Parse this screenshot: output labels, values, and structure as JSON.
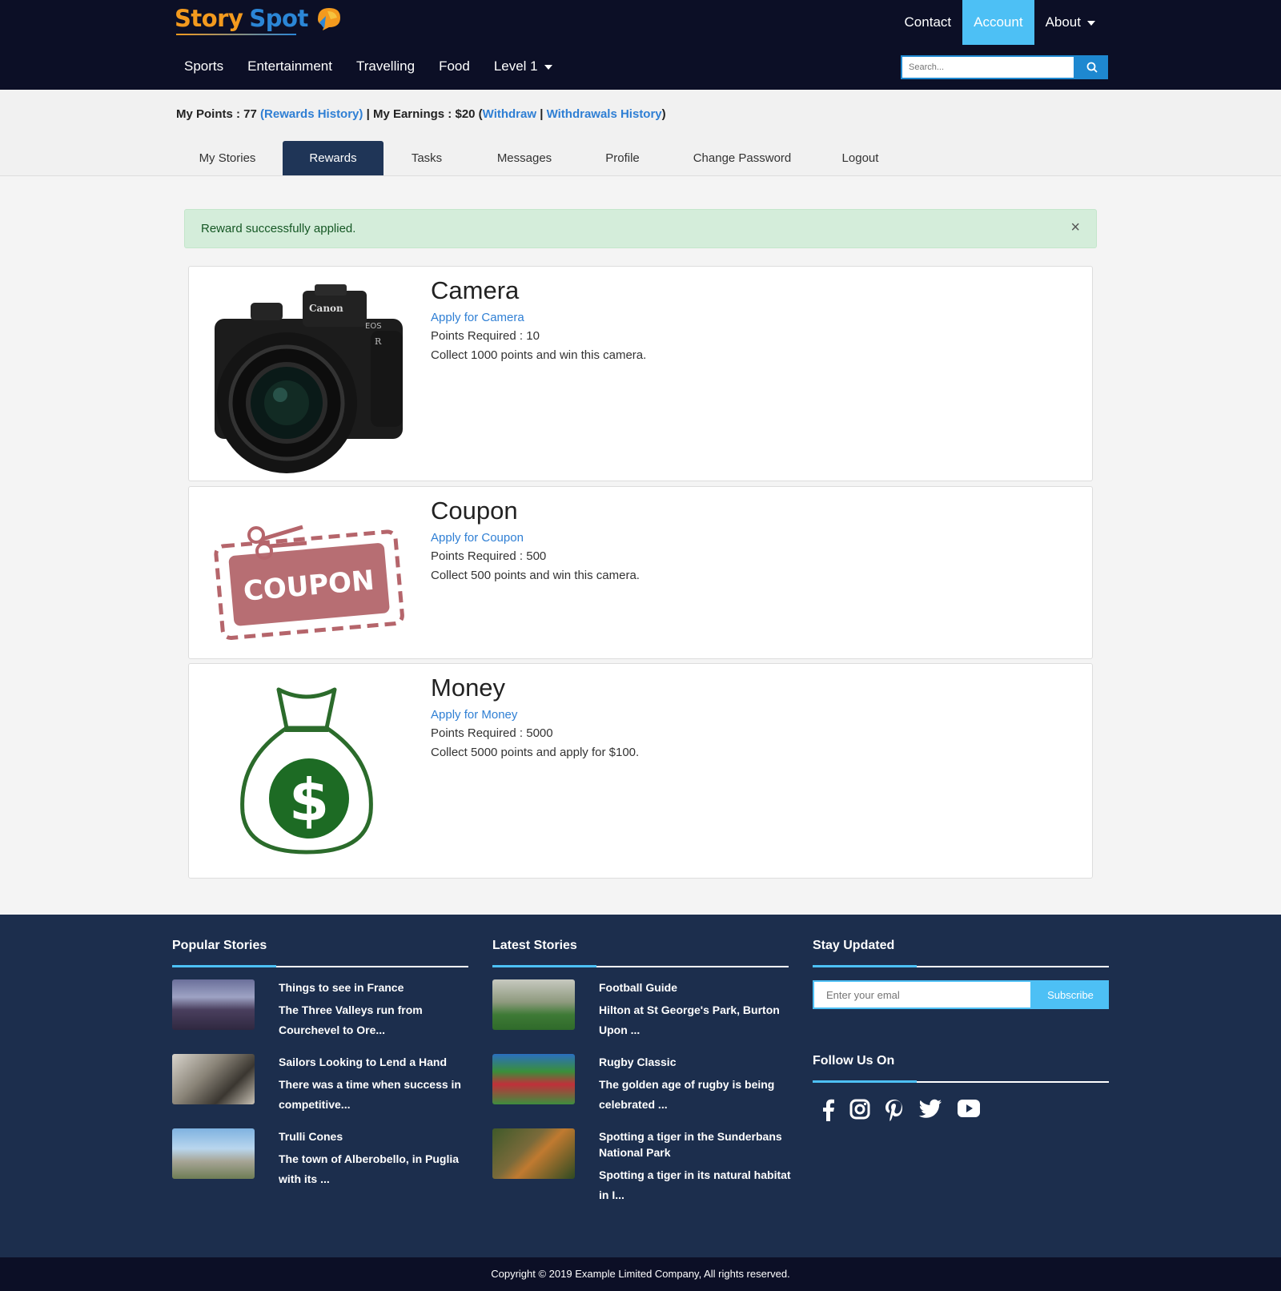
{
  "brand": {
    "word1": "Story",
    "word2": "Spot"
  },
  "topnav": {
    "contact": "Contact",
    "account": "Account",
    "about": "About"
  },
  "catnav": {
    "sports": "Sports",
    "entertainment": "Entertainment",
    "travelling": "Travelling",
    "food": "Food",
    "level": "Level 1"
  },
  "search": {
    "placeholder": "Search..."
  },
  "points": {
    "label": "My Points : 77",
    "rewards_history": "(Rewards History)",
    "sep1": " | ",
    "earnings": "My Earnings : $20 (",
    "withdraw": "Withdraw",
    "sep2": " | ",
    "withdrawals_history": "Withdrawals History",
    "close_paren": ")"
  },
  "tabs": [
    "My Stories",
    "Rewards",
    "Tasks",
    "Messages",
    "Profile",
    "Change Password",
    "Logout"
  ],
  "alert": {
    "message": "Reward successfully applied.",
    "close": "×"
  },
  "rewards": [
    {
      "title": "Camera",
      "apply": "Apply for Camera",
      "points": "Points Required : 10",
      "desc": "Collect 1000 points and win this camera."
    },
    {
      "title": "Coupon",
      "apply": "Apply for Coupon",
      "points": "Points Required : 500",
      "desc": "Collect 500 points and win this camera.",
      "image_text": "COUPON"
    },
    {
      "title": "Money",
      "apply": "Apply for Money",
      "points": "Points Required : 5000",
      "desc": "Collect 5000 points and apply for $100."
    }
  ],
  "footer": {
    "popular": {
      "heading": "Popular Stories",
      "items": [
        {
          "title": "Things to see in France",
          "excerpt": "The Three Valleys run from Courchevel to Ore..."
        },
        {
          "title": "Sailors Looking to Lend a Hand",
          "excerpt": "There was a time when success in competitive..."
        },
        {
          "title": "Trulli Cones",
          "excerpt": "The town of Alberobello, in Puglia with its ..."
        }
      ]
    },
    "latest": {
      "heading": "Latest Stories",
      "items": [
        {
          "title": "Football Guide",
          "excerpt": "Hilton at St George's Park, Burton Upon ..."
        },
        {
          "title": "Rugby Classic",
          "excerpt": "The golden age of rugby is being celebrated ..."
        },
        {
          "title": "Spotting a tiger in the Sunderbans National Park",
          "excerpt": "Spotting a tiger in its natural habitat in I..."
        }
      ]
    },
    "stay": {
      "heading": "Stay Updated",
      "email_placeholder": "Enter your emal",
      "subscribe": "Subscribe"
    },
    "follow": {
      "heading": "Follow Us On",
      "icons": [
        "facebook-icon",
        "instagram-icon",
        "pinterest-icon",
        "twitter-icon",
        "youtube-icon"
      ]
    }
  },
  "copyright": "Copyright © 2019 Example Limited Company, All rights reserved.",
  "colors": {
    "header_bg": "#0c0f26",
    "accent": "#4dc0f5",
    "link": "#2f7fd4",
    "footer_bg": "#1c2e4d",
    "active_tab": "#1f3557",
    "alert_bg": "#d4edda"
  }
}
